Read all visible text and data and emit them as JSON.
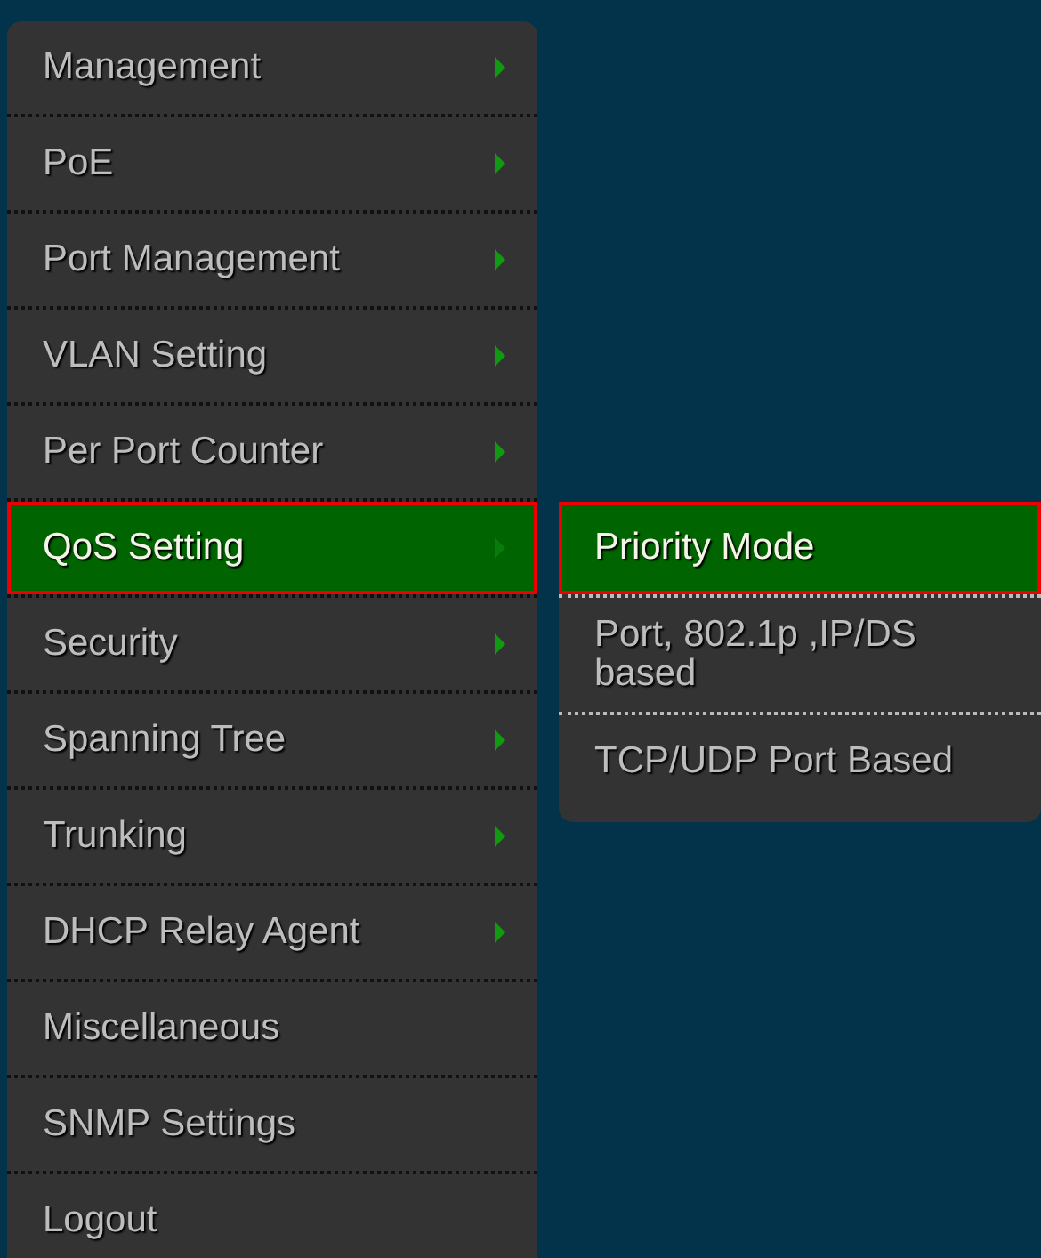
{
  "menu": {
    "items": [
      {
        "label": "Management",
        "selected": false,
        "has_submenu": true
      },
      {
        "label": "PoE",
        "selected": false,
        "has_submenu": true
      },
      {
        "label": "Port Management",
        "selected": false,
        "has_submenu": true
      },
      {
        "label": "VLAN Setting",
        "selected": false,
        "has_submenu": true
      },
      {
        "label": "Per Port Counter",
        "selected": false,
        "has_submenu": true
      },
      {
        "label": "QoS Setting",
        "selected": true,
        "has_submenu": true,
        "submenu": [
          {
            "label": "Priority Mode",
            "selected": true
          },
          {
            "label": "Port, 802.1p ,IP/DS based",
            "selected": false
          },
          {
            "label": "TCP/UDP Port Based",
            "selected": false
          }
        ]
      },
      {
        "label": "Security",
        "selected": false,
        "has_submenu": true
      },
      {
        "label": "Spanning Tree",
        "selected": false,
        "has_submenu": true
      },
      {
        "label": "Trunking",
        "selected": false,
        "has_submenu": true
      },
      {
        "label": "DHCP Relay Agent",
        "selected": false,
        "has_submenu": true
      },
      {
        "label": "Miscellaneous",
        "selected": false,
        "has_submenu": false
      },
      {
        "label": "SNMP Settings",
        "selected": false,
        "has_submenu": false
      },
      {
        "label": "Logout",
        "selected": false,
        "has_submenu": false
      }
    ]
  }
}
